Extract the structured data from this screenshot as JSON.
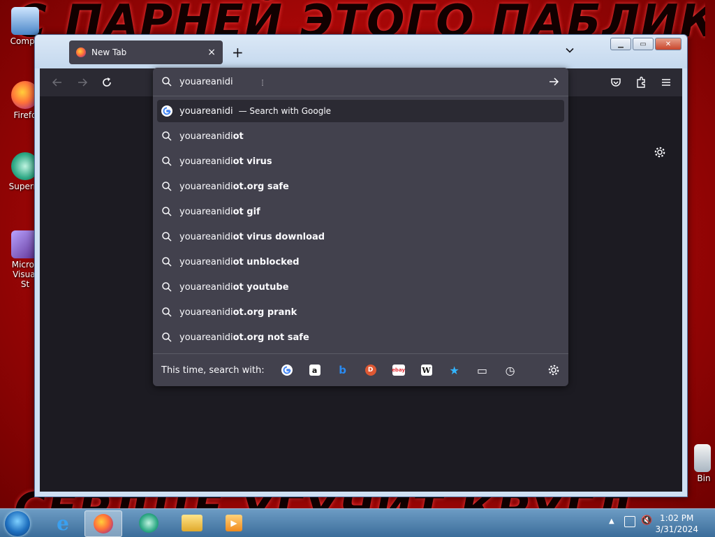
{
  "wallpaper": {
    "top_text": "С ПАРНЕЙ ЭТОГО ПАБЛИКА",
    "bottom_text": "СЕРДЦЕ УГУЧИТ КРУГЛ"
  },
  "desktop_icons": [
    {
      "label": "Compu"
    },
    {
      "label": "Firefo"
    },
    {
      "label": "Superm"
    },
    {
      "label": "Micros Visual St"
    },
    {
      "label": "Bin"
    }
  ],
  "browser": {
    "tab_title": "New Tab",
    "url_input": "youareanidi",
    "heuristic": {
      "text": "youareanidi",
      "action": "— Search with Google"
    },
    "suggestions": [
      {
        "typed": "youareanidi",
        "rest": "ot"
      },
      {
        "typed": "youareanidi",
        "rest": "ot virus"
      },
      {
        "typed": "youareanidi",
        "rest": "ot.org safe"
      },
      {
        "typed": "youareanidi",
        "rest": "ot gif"
      },
      {
        "typed": "youareanidi",
        "rest": "ot virus download"
      },
      {
        "typed": "youareanidi",
        "rest": "ot unblocked"
      },
      {
        "typed": "youareanidi",
        "rest": "ot youtube"
      },
      {
        "typed": "youareanidi",
        "rest": "ot.org prank"
      },
      {
        "typed": "youareanidi",
        "rest": "ot.org not safe"
      }
    ],
    "oneoff_label": "This time, search with:",
    "engines": [
      {
        "name": "google-icon",
        "glyph": "G"
      },
      {
        "name": "amazon-icon",
        "glyph": "a"
      },
      {
        "name": "bing-icon",
        "glyph": "b"
      },
      {
        "name": "duckduckgo-icon",
        "glyph": "D"
      },
      {
        "name": "ebay-icon",
        "glyph": "ebay"
      },
      {
        "name": "wikipedia-icon",
        "glyph": "W"
      },
      {
        "name": "bookmarks-icon",
        "glyph": "★"
      },
      {
        "name": "tabs-icon",
        "glyph": "▭"
      },
      {
        "name": "history-icon",
        "glyph": "◷"
      }
    ]
  },
  "taskbar": {
    "time": "1:02 PM",
    "date": "3/31/2024"
  }
}
